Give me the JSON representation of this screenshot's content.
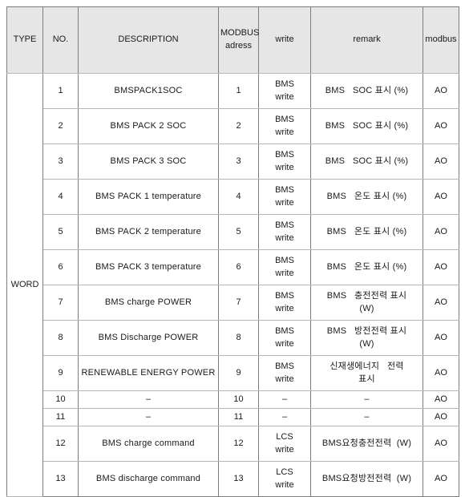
{
  "table": {
    "headers": [
      {
        "key": "type",
        "label": "TYPE"
      },
      {
        "key": "no",
        "label": "NO."
      },
      {
        "key": "desc",
        "label": "DESCRIPTION"
      },
      {
        "key": "addr",
        "label": "MODBUS adress"
      },
      {
        "key": "write",
        "label": "write"
      },
      {
        "key": "remark",
        "label": "remark"
      },
      {
        "key": "modbus",
        "label": "modbus"
      }
    ],
    "type_group_label": "WORD",
    "rows": [
      {
        "no": "1",
        "description": "BMSPACK1SOC",
        "modbus_address": "1",
        "write_line1": "BMS",
        "write_line2": "write",
        "remark_line1": "BMS   SOC 표시 (%)",
        "remark_line2": "",
        "modbus": "AO",
        "height": "tall"
      },
      {
        "no": "2",
        "description": "BMS   PACK 2 SOC",
        "modbus_address": "2",
        "write_line1": "BMS",
        "write_line2": "write",
        "remark_line1": "BMS   SOC 표시 (%)",
        "remark_line2": "",
        "modbus": "AO",
        "height": "tall"
      },
      {
        "no": "3",
        "description": "BMS   PACK 3 SOC",
        "modbus_address": "3",
        "write_line1": "BMS",
        "write_line2": "write",
        "remark_line1": "BMS   SOC 표시 (%)",
        "remark_line2": "",
        "modbus": "AO",
        "height": "tall"
      },
      {
        "no": "4",
        "description": "BMS   PACK 1 temperature",
        "modbus_address": "4",
        "write_line1": "BMS",
        "write_line2": "write",
        "remark_line1": "BMS   온도 표시 (%)",
        "remark_line2": "",
        "modbus": "AO",
        "height": "tall"
      },
      {
        "no": "5",
        "description": "BMS   PACK 2 temperature",
        "modbus_address": "5",
        "write_line1": "BMS",
        "write_line2": "write",
        "remark_line1": "BMS   온도 표시 (%)",
        "remark_line2": "",
        "modbus": "AO",
        "height": "tall"
      },
      {
        "no": "6",
        "description": "BMS   PACK 3 temperature",
        "modbus_address": "6",
        "write_line1": "BMS",
        "write_line2": "write",
        "remark_line1": "BMS   온도 표시 (%)",
        "remark_line2": "",
        "modbus": "AO",
        "height": "tall"
      },
      {
        "no": "7",
        "description": "BMS   charge POWER",
        "modbus_address": "7",
        "write_line1": "BMS",
        "write_line2": "write",
        "remark_line1": "BMS   충전전력 표시",
        "remark_line2": "(W)",
        "modbus": "AO",
        "height": "tall"
      },
      {
        "no": "8",
        "description": "BMS   Discharge POWER",
        "modbus_address": "8",
        "write_line1": "BMS",
        "write_line2": "write",
        "remark_line1": "BMS   방전전력 표시",
        "remark_line2": "(W)",
        "modbus": "AO",
        "height": "tall"
      },
      {
        "no": "9",
        "description": "RENEWABLE   ENERGY POWER",
        "modbus_address": "9",
        "write_line1": "BMS",
        "write_line2": "write",
        "remark_line1": "신재생에너지   전력",
        "remark_line2": "표시",
        "modbus": "AO",
        "height": "tall"
      },
      {
        "no": "10",
        "description": "–",
        "modbus_address": "10",
        "write_line1": "–",
        "write_line2": "",
        "remark_line1": "–",
        "remark_line2": "",
        "modbus": "AO",
        "height": "short"
      },
      {
        "no": "11",
        "description": "–",
        "modbus_address": "11",
        "write_line1": "–",
        "write_line2": "",
        "remark_line1": "–",
        "remark_line2": "",
        "modbus": "AO",
        "height": "short"
      },
      {
        "no": "12",
        "description": "BMS   charge command",
        "modbus_address": "12",
        "write_line1": "LCS",
        "write_line2": "write",
        "remark_line1": "BMS요청충전전력  (W)",
        "remark_line2": "",
        "modbus": "AO",
        "height": "tall"
      },
      {
        "no": "13",
        "description": "BMS   discharge command",
        "modbus_address": "13",
        "write_line1": "LCS",
        "write_line2": "write",
        "remark_line1": "BMS요청방전전력  (W)",
        "remark_line2": "",
        "modbus": "AO",
        "height": "tall"
      }
    ]
  },
  "colors": {
    "header_background": "#e6e6e6",
    "outer_border": "#7d7d7d",
    "inner_border": "#b4b4b4",
    "text": "#1a1a1a"
  }
}
